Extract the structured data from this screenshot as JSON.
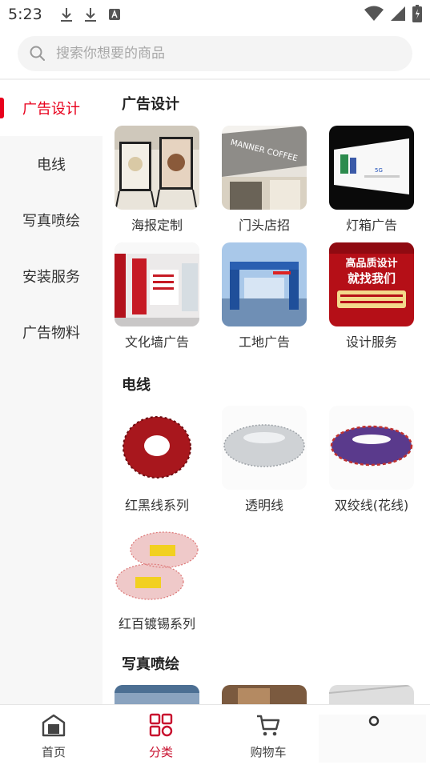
{
  "status_bar": {
    "time": "5:23"
  },
  "search": {
    "placeholder": "搜索你想要的商品"
  },
  "sidebar": {
    "items": [
      {
        "label": "广告设计",
        "active": true
      },
      {
        "label": "电线",
        "active": false
      },
      {
        "label": "写真喷绘",
        "active": false
      },
      {
        "label": "安装服务",
        "active": false
      },
      {
        "label": "广告物料",
        "active": false
      }
    ]
  },
  "sections": {
    "ad_design": {
      "title": "广告设计",
      "items": [
        {
          "label": "海报定制",
          "icon": "poster-stand-image"
        },
        {
          "label": "门头店招",
          "icon": "storefront-sign-image"
        },
        {
          "label": "灯箱广告",
          "icon": "lightbox-image"
        },
        {
          "label": "文化墙广告",
          "icon": "culture-wall-image"
        },
        {
          "label": "工地广告",
          "icon": "construction-gate-image"
        },
        {
          "label": "设计服务",
          "icon": "design-service-banner-image",
          "banner_line1": "高品质设计",
          "banner_line2": "就找我们"
        }
      ]
    },
    "wire": {
      "title": "电线",
      "items": [
        {
          "label": "红黑线系列",
          "icon": "red-black-wire-coil-image"
        },
        {
          "label": "透明线",
          "icon": "transparent-wire-coil-image"
        },
        {
          "label": "双绞线(花线)",
          "icon": "twisted-pair-wire-coil-image"
        },
        {
          "label": "红百镀锡系列",
          "icon": "tinned-wire-rolls-image"
        }
      ]
    },
    "print": {
      "title": "写真喷绘"
    }
  },
  "bottom_nav": {
    "items": [
      {
        "label": "首页",
        "icon": "home-icon",
        "active": false
      },
      {
        "label": "分类",
        "icon": "category-grid-icon",
        "active": true
      },
      {
        "label": "购物车",
        "icon": "cart-icon",
        "active": false
      }
    ]
  },
  "colors": {
    "accent": "#e8001c",
    "nav_active": "#c8102e",
    "sidebar_bg": "#f7f7f7"
  }
}
